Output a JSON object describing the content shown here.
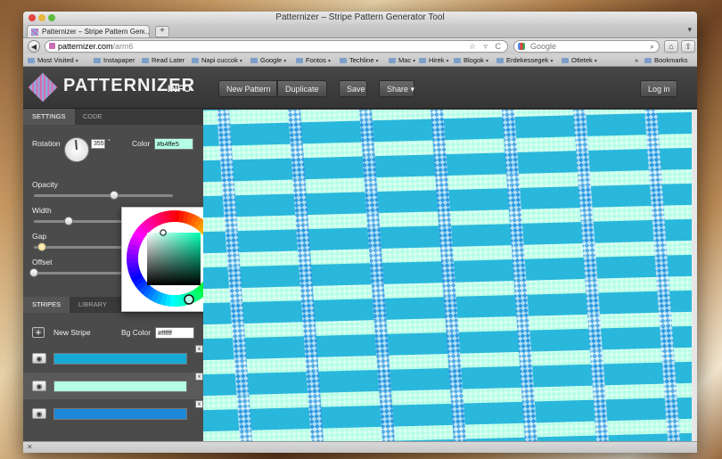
{
  "window": {
    "title": "Patternizer – Stripe Pattern Generator Tool"
  },
  "tab": {
    "label": "Patternizer – Stripe Pattern Gen...",
    "close_icon": "×",
    "newtab_label": "+",
    "menu_icon": "▾"
  },
  "nav": {
    "url_host": "patternizer.com",
    "url_path": "/arm6",
    "search_placeholder": "Google",
    "back_icon": "◀",
    "home_icon": "⌂",
    "ext_icon": "⇧"
  },
  "bookmarks": {
    "items": [
      "Most Visited",
      "Instapaper",
      "Read Later",
      "Napi cuccok",
      "Google",
      "Fontos",
      "Techline",
      "Mac",
      "Hirek",
      "Blogok",
      "Erdekessegek",
      "Otletek"
    ],
    "more": "»",
    "bookmarks_menu": "Bookmarks"
  },
  "app": {
    "logo_text": "PATTERNIZER",
    "info_label": "INFO",
    "buttons": {
      "new_pattern": "New Pattern",
      "duplicate": "Duplicate",
      "save": "Save",
      "share": "Share ▾",
      "login": "Log in"
    }
  },
  "settings": {
    "tabs": [
      "SETTINGS",
      "CODE"
    ],
    "rotation_label": "Rotation",
    "rotation_value": "355",
    "rotation_unit": "°",
    "color_label": "Color",
    "color_value": "#b4ffe5",
    "color_hex": "#b4ffe5",
    "opacity_label": "Opacity",
    "width_label": "Width",
    "gap_label": "Gap",
    "offset_label": "Offset",
    "offset_value": "0",
    "opacity_level": 0.58,
    "width_level": 0.25,
    "gap_level": 0.06,
    "offset_level": 0.0
  },
  "stripes": {
    "tabs": [
      "STRIPES",
      "LIBRARY"
    ],
    "new_stripe_label": "New Stripe",
    "plus_label": "+",
    "bg_color_label": "Bg Color",
    "bg_color_value": "#ffffff",
    "items": [
      {
        "color": "#17a9d6",
        "eye": "◉",
        "x": "x"
      },
      {
        "color": "#b4ffe5",
        "eye": "◉",
        "x": "x"
      },
      {
        "color": "#1e88d8",
        "eye": "◉",
        "x": "x"
      }
    ]
  },
  "status": {
    "icon": "✕"
  },
  "colors": {
    "header": "#404040",
    "sidebar": "#4b4b4b",
    "pattern_base": "#2ab7dc",
    "pattern_light": "#b4ffe5",
    "pattern_blue": "#1e88d8"
  }
}
